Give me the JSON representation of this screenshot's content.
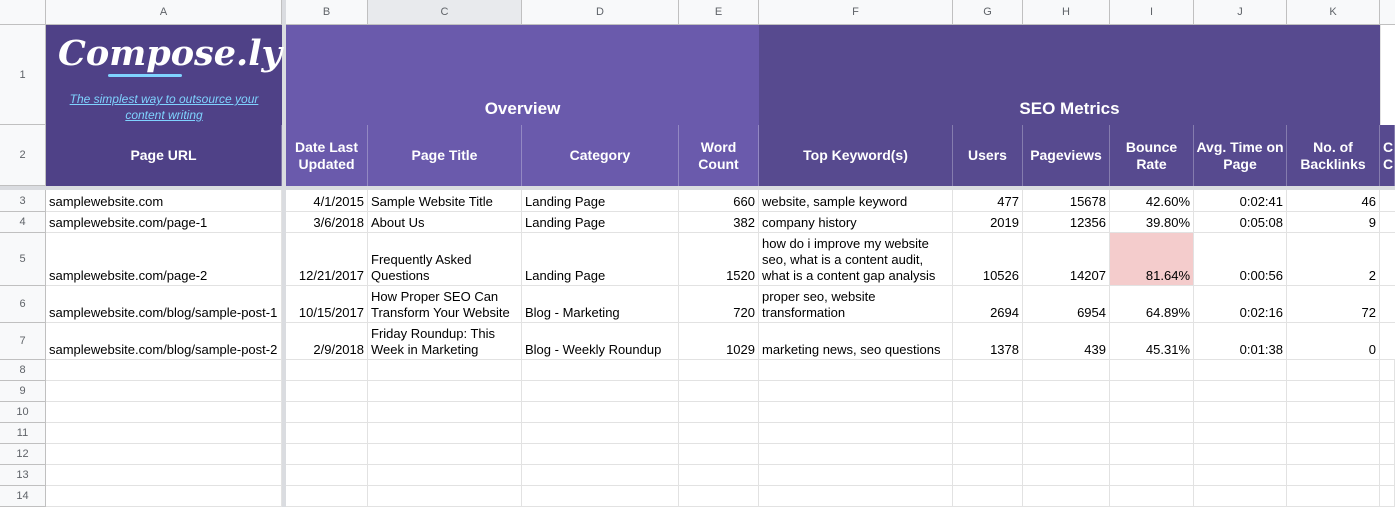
{
  "columns": [
    "A",
    "B",
    "C",
    "D",
    "E",
    "F",
    "G",
    "H",
    "I",
    "J",
    "K"
  ],
  "row_numbers": [
    "1",
    "2",
    "3",
    "4",
    "5",
    "6",
    "7",
    "8",
    "9",
    "10",
    "11",
    "12",
    "13",
    "14"
  ],
  "brand": {
    "logo_text": "Compose.ly",
    "tagline": "The simplest way to outsource your content writing",
    "colors": {
      "dark_purple": "#4f4187",
      "mid_purple": "#6a5aac",
      "seo_purple": "#574a8f",
      "link_blue": "#7fd3ff"
    }
  },
  "banners": {
    "overview": "Overview",
    "seo": "SEO Metrics"
  },
  "headers": {
    "page_url": "Page URL",
    "date_updated": "Date Last Updated",
    "page_title": "Page Title",
    "category": "Category",
    "word_count": "Word Count",
    "top_keywords": "Top Keyword(s)",
    "users": "Users",
    "pageviews": "Pageviews",
    "bounce_rate": "Bounce Rate",
    "avg_time": "Avg. Time on Page",
    "backlinks": "No. of Backlinks",
    "cut_off": "C C"
  },
  "rows": [
    {
      "url": "samplewebsite.com",
      "date": "4/1/2015",
      "title": "Sample Website Title",
      "category": "Landing Page",
      "words": "660",
      "keywords": "website, sample keyword",
      "users": "477",
      "pageviews": "15678",
      "bounce": "42.60%",
      "time": "0:02:41",
      "backlinks": "46"
    },
    {
      "url": "samplewebsite.com/page-1",
      "date": "3/6/2018",
      "title": "About Us",
      "category": "Landing Page",
      "words": "382",
      "keywords": "company history",
      "users": "2019",
      "pageviews": "12356",
      "bounce": "39.80%",
      "time": "0:05:08",
      "backlinks": "9"
    },
    {
      "url": "samplewebsite.com/page-2",
      "date": "12/21/2017",
      "title": "Frequently Asked Questions",
      "category": "Landing Page",
      "words": "1520",
      "keywords": "how do i improve my website seo, what is a content audit, what is a content gap analysis",
      "users": "10526",
      "pageviews": "14207",
      "bounce": "81.64%",
      "time": "0:00:56",
      "backlinks": "2"
    },
    {
      "url": "samplewebsite.com/blog/sample-post-1",
      "date": "10/15/2017",
      "title": "How Proper SEO Can Transform Your Website",
      "category": "Blog - Marketing",
      "words": "720",
      "keywords": "proper seo, website transformation",
      "users": "2694",
      "pageviews": "6954",
      "bounce": "64.89%",
      "time": "0:02:16",
      "backlinks": "72"
    },
    {
      "url": "samplewebsite.com/blog/sample-post-2",
      "date": "2/9/2018",
      "title": "Friday Roundup: This Week in Marketing",
      "category": "Blog - Weekly Roundup",
      "words": "1029",
      "keywords": "marketing news, seo questions",
      "users": "1378",
      "pageviews": "439",
      "bounce": "45.31%",
      "time": "0:01:38",
      "backlinks": "0"
    }
  ]
}
